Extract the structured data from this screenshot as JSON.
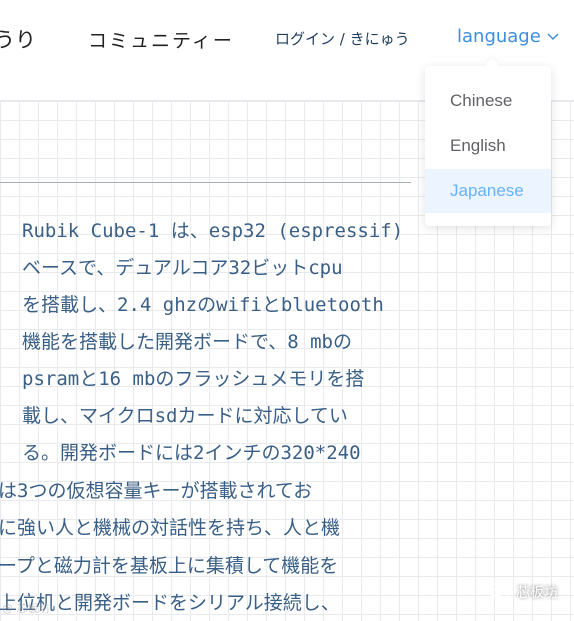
{
  "header": {
    "nav_fragment": "うり",
    "community": "コミュニティー",
    "login": "ログイン / きにゅう",
    "language_label": "language"
  },
  "language_menu": {
    "options": [
      "Chinese",
      "English",
      "Japanese"
    ],
    "selected": "Japanese"
  },
  "article": {
    "lines": [
      "Rubik Cube-1 は、esp32 (espressif)",
      "ベースで、デュアルコア32ビットcpu",
      "を搭載し、2.4 ghzのwifiとbluetooth",
      "機能を搭載した開発ボードで、8 mbの",
      "psramと16 mbのフラッシュメモリを搭",
      "載し、マイクロsdカードに対応してい",
      "る。開発ボードには2インチの320*240",
      "は3つの仮想容量キーが搭載されてお",
      "に強い人と機械の対話性を持ち、人と機",
      "ープと磁力計を基板上に集積して機能を",
      "上位机と開発ボードをシリアル接続し、"
    ]
  },
  "watermark": {
    "label": "芯板坊",
    "faint": "@ 芯板坊"
  },
  "colors": {
    "accent": "#3d8ee0",
    "selected_bg": "#ecf5ff",
    "selected_text": "#66b1ff",
    "body_text": "#3a5f86"
  }
}
